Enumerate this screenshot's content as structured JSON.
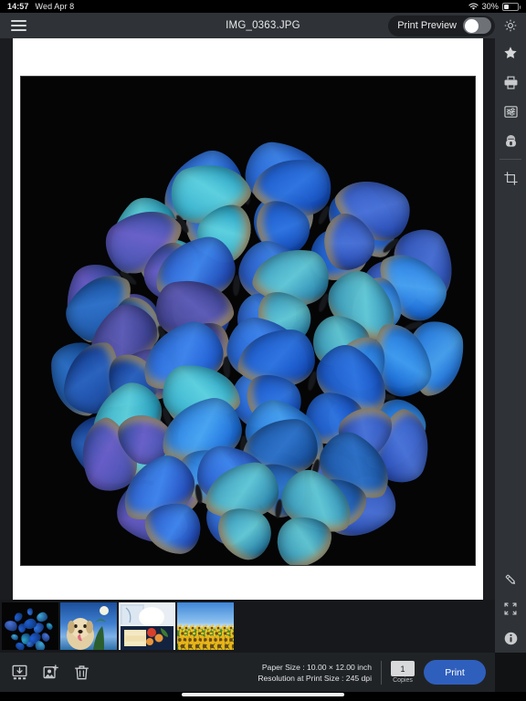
{
  "status_bar": {
    "time": "14:57",
    "date": "Wed Apr 8",
    "battery_percent": "30%",
    "wifi_icon": "wifi-icon",
    "battery_icon": "battery-icon"
  },
  "toolbar": {
    "menu_icon": "hamburger-menu-icon",
    "document_title": "IMG_0363.JPG",
    "print_preview_label": "Print Preview",
    "print_preview_on": true,
    "settings_icon": "gear-icon"
  },
  "right_rail": {
    "items": [
      {
        "name": "favorite",
        "icon": "star-icon",
        "label": "Favorite"
      },
      {
        "name": "printer-settings",
        "icon": "printer-icon",
        "label": "Printer Settings"
      },
      {
        "name": "paper-settings",
        "icon": "sliders-panel-icon",
        "label": "Paper Settings"
      },
      {
        "name": "print-head",
        "icon": "paint-roller-icon",
        "label": "Print Head"
      },
      {
        "name": "crop",
        "icon": "crop-icon",
        "label": "Crop"
      }
    ],
    "bottom_items": [
      {
        "name": "edit",
        "icon": "pencil-icon",
        "label": "Edit"
      },
      {
        "name": "fullscreen",
        "icon": "expand-arrows-icon",
        "label": "Fullscreen"
      },
      {
        "name": "info",
        "icon": "info-circle-icon",
        "label": "Info"
      }
    ]
  },
  "filmstrip": {
    "thumbnails": [
      {
        "name": "thumbnail-butterflies",
        "alt": "Blue morpho butterflies on black",
        "selected": true
      },
      {
        "name": "thumbnail-dog",
        "alt": "Labrador puppy under blue sky",
        "selected": false
      },
      {
        "name": "thumbnail-bento",
        "alt": "Japanese bento box with rice",
        "selected": false
      },
      {
        "name": "thumbnail-sunflowers",
        "alt": "Sunflower field under blue sky",
        "selected": false
      }
    ]
  },
  "bottom_bar": {
    "save_icon": "save-image-icon",
    "add_icon": "add-image-icon",
    "delete_icon": "trash-icon",
    "paper_size_line": "Paper Size : 10.00 × 12.00 inch",
    "resolution_line": "Resolution at Print Size : 245 dpi",
    "copies_value": "1",
    "copies_label": "Copies",
    "print_label": "Print"
  },
  "colors": {
    "accent": "#2f5fbd",
    "selection": "#2f6fe0",
    "toolbar": "#2f3337",
    "rail": "#2f3337",
    "bottom_bar": "#202326",
    "workspace": "#1a1c1f",
    "page": "#ffffff",
    "photo_background": "#050506"
  },
  "main_image": {
    "name": "print-preview-photo",
    "alt": "Cluster of blue morpho butterflies arranged in a circle on black background"
  }
}
